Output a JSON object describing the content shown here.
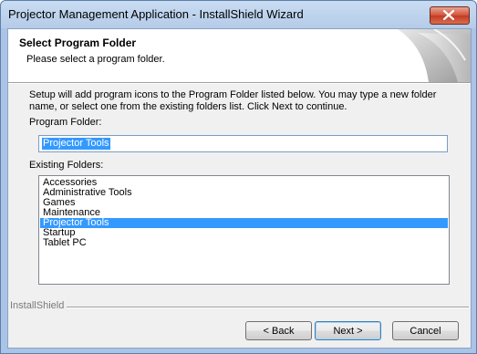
{
  "window": {
    "title": "Projector Management Application - InstallShield Wizard",
    "close_icon": "close-icon"
  },
  "header": {
    "title": "Select Program Folder",
    "subtitle": "Please select a program folder."
  },
  "body": {
    "instructions": "Setup will add program icons to the Program Folder listed below.  You may type a new folder name, or select one from the existing folders list.  Click Next to continue.",
    "program_folder_label": "Program Folder:",
    "program_folder_value": "Projector Tools",
    "existing_folders_label": "Existing Folders:",
    "existing_folders": [
      "Accessories",
      "Administrative Tools",
      "Games",
      "Maintenance",
      "Projector Tools",
      "Startup",
      "Tablet PC"
    ],
    "selected_folder": "Projector Tools"
  },
  "footer": {
    "brand_label": "InstallShield",
    "back_label": "< Back",
    "next_label": "Next >",
    "cancel_label": "Cancel"
  },
  "colors": {
    "selection": "#3399ff",
    "title_bar": "#b4cbe8",
    "close_button": "#c33b22"
  }
}
